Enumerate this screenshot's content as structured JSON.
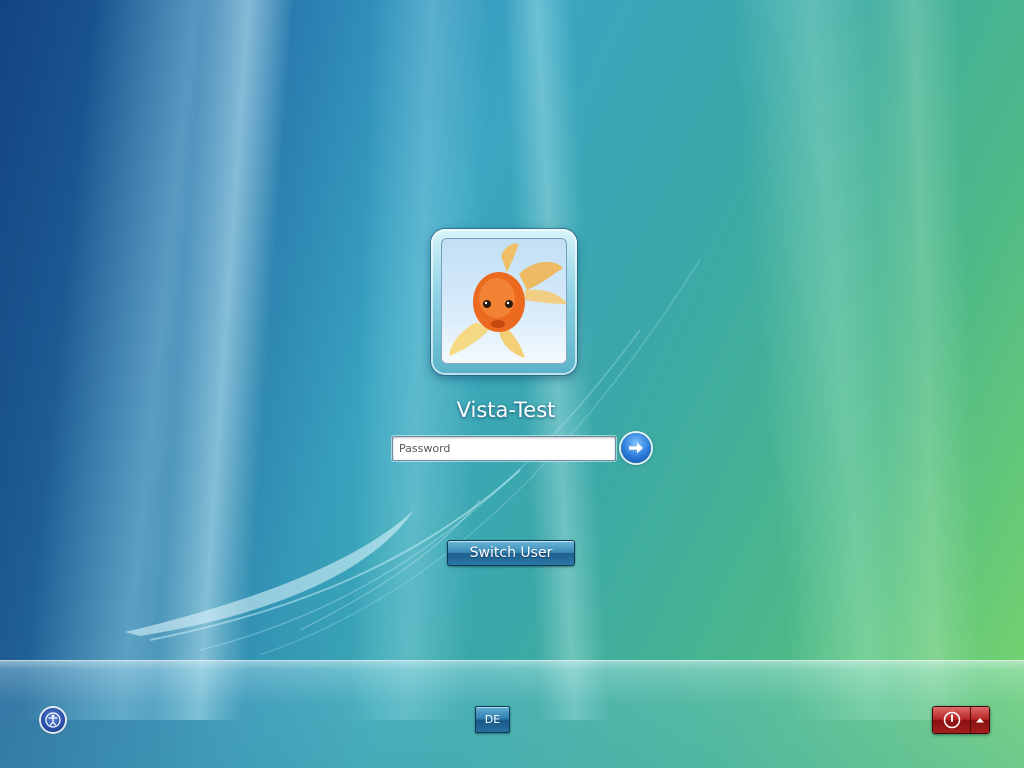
{
  "login": {
    "username": "Vista-Test",
    "password_value": "",
    "password_placeholder": "Password",
    "switch_user_label": "Switch User"
  },
  "bottom_bar": {
    "language_label": "DE"
  },
  "icons": {
    "submit": "arrow-right-icon",
    "ease_of_access": "ease-of-access-icon",
    "power": "power-icon",
    "power_menu": "chevron-up-icon",
    "avatar": "goldfish-picture"
  },
  "colors": {
    "switch_user_button": "#2b78a6",
    "power_button": "#b52424",
    "submit_button": "#2a7ad8"
  }
}
